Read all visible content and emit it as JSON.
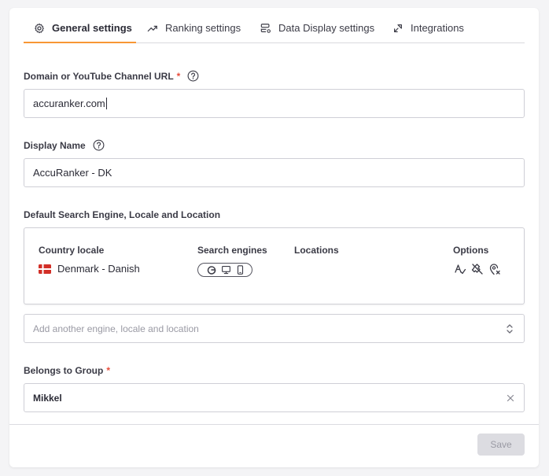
{
  "tabs": [
    {
      "label": "General settings",
      "icon": "gear-icon",
      "active": true
    },
    {
      "label": "Ranking settings",
      "icon": "trending-up-icon",
      "active": false
    },
    {
      "label": "Data Display settings",
      "icon": "database-settings-icon",
      "active": false
    },
    {
      "label": "Integrations",
      "icon": "integration-arrows-icon",
      "active": false
    }
  ],
  "accent_color": "#f89734",
  "domain": {
    "label": "Domain or YouTube Channel URL",
    "required_mark": "*",
    "value": "accuranker.com"
  },
  "display_name": {
    "label": "Display Name",
    "value": "AccuRanker - DK"
  },
  "search_section": {
    "label": "Default Search Engine, Locale and Location",
    "headers": {
      "country_locale": "Country locale",
      "search_engines": "Search engines",
      "locations": "Locations",
      "options": "Options"
    },
    "row": {
      "locale": "Denmark - Danish",
      "flag": "denmark-flag-icon",
      "engines": [
        "google-icon",
        "desktop-icon",
        "mobile-icon"
      ],
      "options": [
        "autocorrect-icon",
        "ignore-local-pack-icon",
        "location-off-icon"
      ]
    },
    "add_placeholder": "Add another engine, locale and location"
  },
  "group": {
    "label": "Belongs to Group",
    "required_mark": "*",
    "value": "Mikkel"
  },
  "save_label": "Save"
}
